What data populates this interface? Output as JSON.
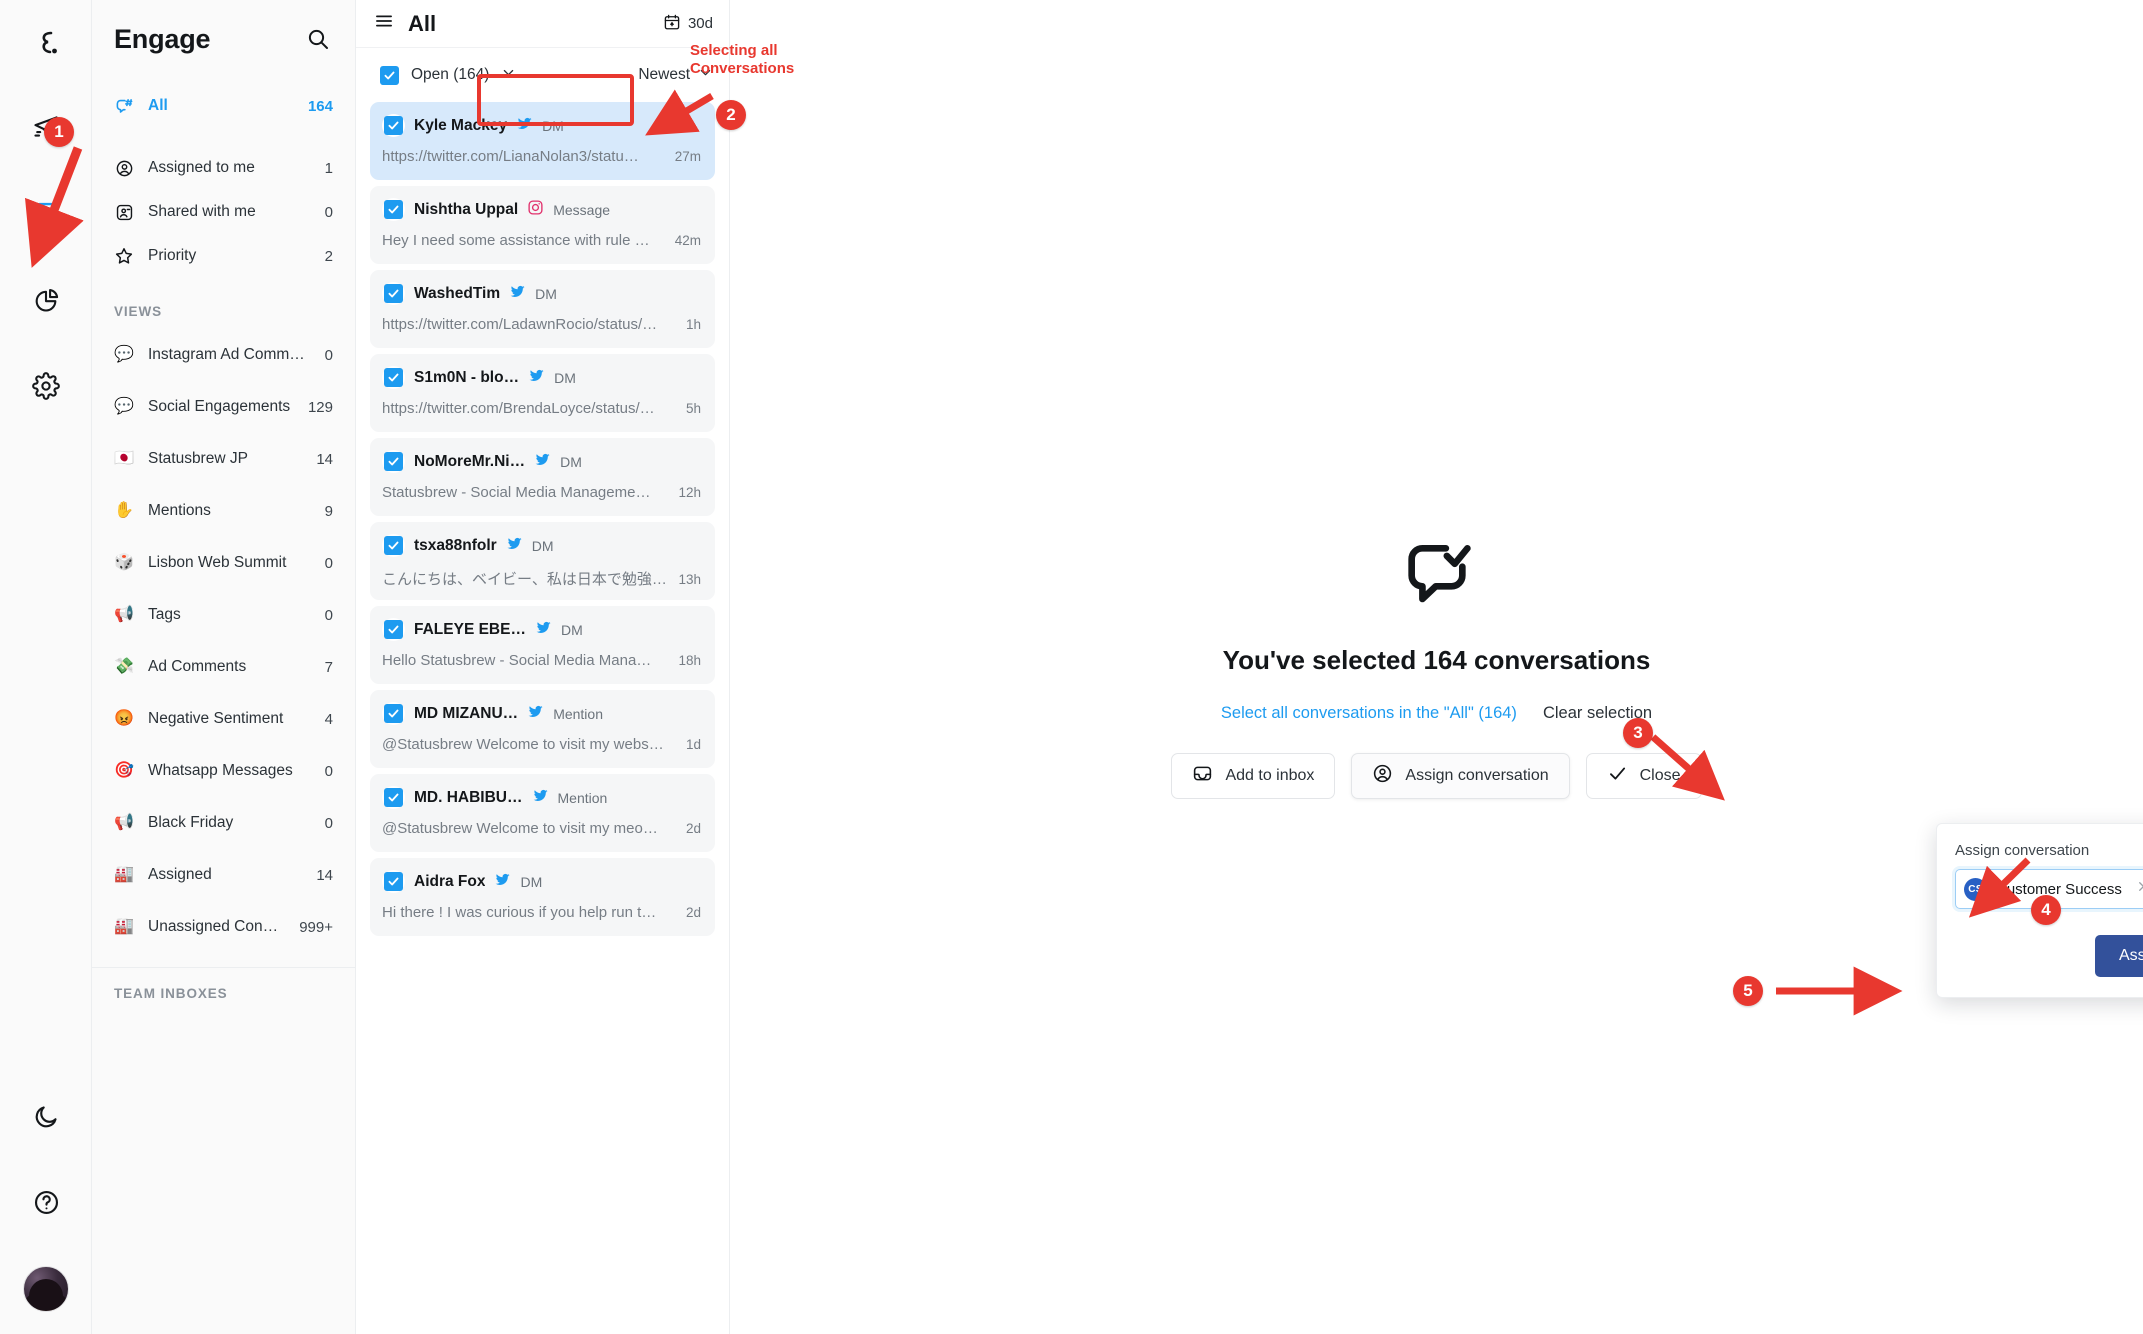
{
  "rail": {
    "logo_name": "statusbrew-logo",
    "icons": [
      {
        "name": "publish-icon",
        "title": "Publish"
      },
      {
        "name": "inbox-icon",
        "title": "Engage"
      },
      {
        "name": "reports-icon",
        "title": "Reports"
      },
      {
        "name": "settings-icon",
        "title": "Settings"
      }
    ],
    "bottom": [
      {
        "name": "dark-mode-icon",
        "title": "Dark mode"
      },
      {
        "name": "help-icon",
        "title": "Help"
      },
      {
        "name": "avatar",
        "title": "Account"
      }
    ]
  },
  "sidebar": {
    "title": "Engage",
    "search_icon": "search-icon",
    "primary": [
      {
        "label": "All",
        "count": "164",
        "icon": "conversations-hash-icon",
        "active": true
      },
      {
        "label": "Assigned to me",
        "count": "1",
        "icon": "person-circle-icon",
        "active": false
      },
      {
        "label": "Shared with me",
        "count": "0",
        "icon": "shared-person-icon",
        "active": false
      },
      {
        "label": "Priority",
        "count": "2",
        "icon": "star-icon",
        "active": false
      }
    ],
    "views_header": "VIEWS",
    "views": [
      {
        "label": "Instagram Ad Comments",
        "count": "0",
        "emoji": "💬"
      },
      {
        "label": "Social Engagements",
        "count": "129",
        "emoji": "💬"
      },
      {
        "label": "Statusbrew JP",
        "count": "14",
        "emoji": "🇯🇵"
      },
      {
        "label": "Mentions",
        "count": "9",
        "emoji": "✋"
      },
      {
        "label": "Lisbon Web Summit",
        "count": "0",
        "emoji": "🎲"
      },
      {
        "label": "Tags",
        "count": "0",
        "emoji": "📢"
      },
      {
        "label": "Ad Comments",
        "count": "7",
        "emoji": "💸"
      },
      {
        "label": "Negative Sentiment",
        "count": "4",
        "emoji": "😡"
      },
      {
        "label": "Whatsapp Messages",
        "count": "0",
        "emoji": "🎯"
      },
      {
        "label": "Black Friday",
        "count": "0",
        "emoji": "📢"
      },
      {
        "label": "Assigned",
        "count": "14",
        "emoji": "🏭"
      },
      {
        "label": "Unassigned Conversati…",
        "count": "999+",
        "emoji": "🏭"
      }
    ],
    "team_inboxes_header": "TEAM INBOXES"
  },
  "conversations_header": {
    "menu_icon": "hamburger-menu-icon",
    "title": "All",
    "date_filter": "30d",
    "date_icon": "calendar-icon",
    "status_filter": "Open (164)",
    "sort": "Newest"
  },
  "conversations": [
    {
      "name": "Kyle Mackey",
      "channel_icon": "twitter-icon",
      "channel": "DM",
      "preview": "https://twitter.com/LianaNolan3/statu…",
      "time": "27m",
      "selected": true,
      "checked": true
    },
    {
      "name": "Nishtha Uppal",
      "channel_icon": "instagram-icon",
      "channel": "Message",
      "preview": "Hey I need some assistance with rule …",
      "time": "42m",
      "selected": false,
      "checked": true
    },
    {
      "name": "WashedTim",
      "channel_icon": "twitter-icon",
      "channel": "DM",
      "preview": "https://twitter.com/LadawnRocio/status/…",
      "time": "1h",
      "selected": false,
      "checked": true
    },
    {
      "name": "S1m0N - blo…",
      "channel_icon": "twitter-icon",
      "channel": "DM",
      "preview": "https://twitter.com/BrendaLoyce/status/…",
      "time": "5h",
      "selected": false,
      "checked": true
    },
    {
      "name": "NoMoreMr.Ni…",
      "channel_icon": "twitter-icon",
      "channel": "DM",
      "preview": "Statusbrew - Social Media Manageme…",
      "time": "12h",
      "selected": false,
      "checked": true
    },
    {
      "name": "tsxa88nfolr",
      "channel_icon": "twitter-icon",
      "channel": "DM",
      "preview": "こんにちは、ベイビー、私は日本で勉強…",
      "time": "13h",
      "selected": false,
      "checked": true
    },
    {
      "name": "FALEYE EBE…",
      "channel_icon": "twitter-icon",
      "channel": "DM",
      "preview": "Hello Statusbrew - Social Media Mana…",
      "time": "18h",
      "selected": false,
      "checked": true
    },
    {
      "name": "MD MIZANU…",
      "channel_icon": "twitter-icon",
      "channel": "Mention",
      "preview": "@Statusbrew Welcome to visit my webs…",
      "time": "1d",
      "selected": false,
      "checked": true
    },
    {
      "name": "MD. HABIBU…",
      "channel_icon": "twitter-icon",
      "channel": "Mention",
      "preview": "@Statusbrew Welcome to visit my meo…",
      "time": "2d",
      "selected": false,
      "checked": true
    },
    {
      "name": "Aidra Fox",
      "channel_icon": "twitter-icon",
      "channel": "DM",
      "preview": "Hi there ! I was curious if you help run t…",
      "time": "2d",
      "selected": false,
      "checked": true
    }
  ],
  "bulk": {
    "icon": "chat-check-icon",
    "title": "You've selected 164 conversations",
    "select_all_link": "Select all conversations in the \"All\" (164)",
    "clear_link": "Clear selection",
    "buttons": [
      {
        "label": "Add to inbox",
        "icon": "inbox-icon"
      },
      {
        "label": "Assign conversation",
        "icon": "person-circle-icon"
      },
      {
        "label": "Close",
        "icon": "check-icon"
      }
    ]
  },
  "assign_popover": {
    "label": "Assign conversation",
    "chip_initials": "CS",
    "chip_name": "Customer Success",
    "clear_icon": "close-icon",
    "caret_icon": "chevron-down-icon",
    "submit_label": "Assign"
  },
  "annotations": {
    "note_line1": "Selecting all",
    "note_line2": "Conversations",
    "badges": [
      "1",
      "2",
      "3",
      "4",
      "5"
    ],
    "color": "#e8382f"
  },
  "colors": {
    "accent_blue": "#1d9bf0",
    "annotation_red": "#e8382f",
    "assign_button": "#33519b",
    "selected_row": "#d7e9fb"
  }
}
